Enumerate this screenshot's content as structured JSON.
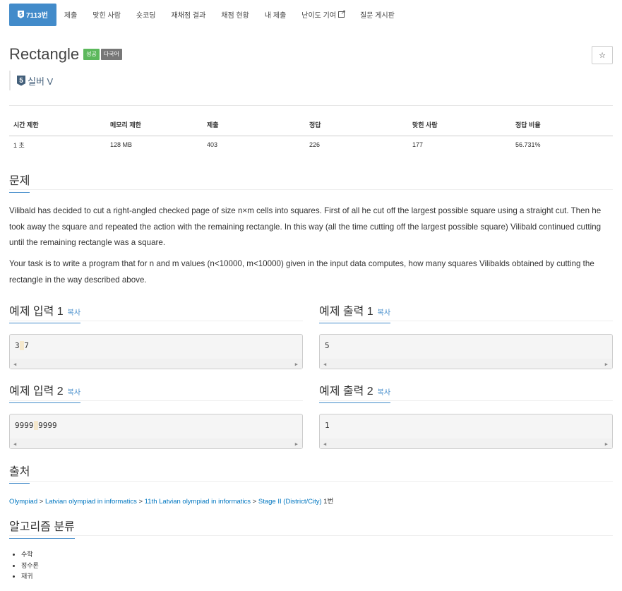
{
  "nav": {
    "active": {
      "badge": "5",
      "label": "7113번"
    },
    "tabs": [
      "제출",
      "맞힌 사람",
      "숏코딩",
      "재채점 결과",
      "채점 현황",
      "내 제출"
    ],
    "external_tab": "난이도 기여",
    "last_tab": "질문 게시판"
  },
  "problem": {
    "title": "Rectangle",
    "labels": [
      "성공",
      "다국어"
    ],
    "star": "☆",
    "tier_num": "5",
    "tier": "실버 V"
  },
  "info": {
    "headers": [
      "시간 제한",
      "메모리 제한",
      "제출",
      "정답",
      "맞힌 사람",
      "정답 비율"
    ],
    "values": [
      "1 초",
      "128 MB",
      "403",
      "226",
      "177",
      "56.731%"
    ]
  },
  "section": {
    "problem": "문제",
    "source": "출처",
    "algorithm": "알고리즘 분류"
  },
  "description": [
    "Vilibald has decided to cut a right-angled checked page of size n×m cells into squares. First of all he cut off the largest possible square using a straight cut. Then he took away the square and repeated the action with the remaining rectangle. In this way (all the time cutting off the largest possible square) Vilibald continued cutting until the remaining rectangle was a square.",
    "Your task is to write a program that for n and m values (n<10000, m<10000) given in the input data computes, how many squares Vilibalds obtained by cutting the rectangle in the way described above."
  ],
  "samples": {
    "copy_label": "복사",
    "in1_title": "예제 입력 1",
    "in1_a": "3",
    "in1_b": "7",
    "out1_title": "예제 출력 1",
    "out1": "5",
    "in2_title": "예제 입력 2",
    "in2_a": "9999",
    "in2_b": "9999",
    "out2_title": "예제 출력 2",
    "out2": "1"
  },
  "source_links": [
    "Olympiad",
    "Latvian olympiad in informatics",
    "11th Latvian olympiad in informatics",
    "Stage II (District/City)"
  ],
  "source_suffix": "1번",
  "source_sep": ">",
  "algorithms": [
    "수학",
    "정수론",
    "재귀"
  ]
}
